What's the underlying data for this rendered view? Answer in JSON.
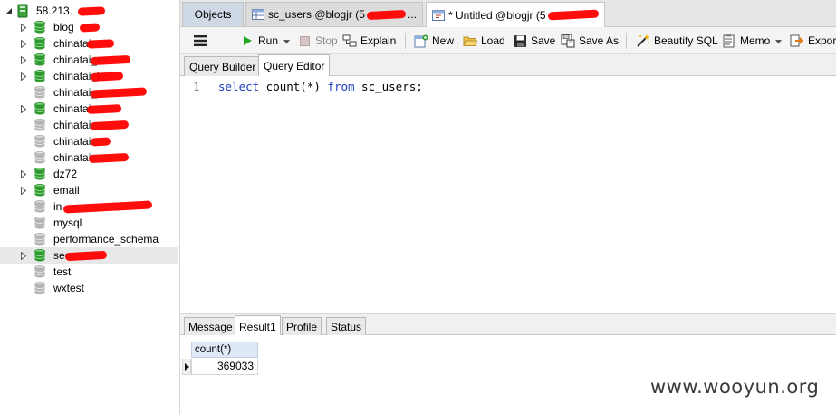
{
  "sidebar": {
    "connection_label": "58.213.",
    "items": [
      {
        "label": "blog",
        "icon": "green",
        "expandable": true
      },
      {
        "label": "chinatai",
        "icon": "green",
        "expandable": true
      },
      {
        "label": "chinatai_c",
        "icon": "green",
        "expandable": true
      },
      {
        "label": "chinatai_l",
        "icon": "green",
        "expandable": true
      },
      {
        "label": "chinatai_",
        "icon": "gray",
        "expandable": false
      },
      {
        "label": "chinatai",
        "icon": "green",
        "expandable": true
      },
      {
        "label": "chinatai",
        "icon": "gray",
        "expandable": false
      },
      {
        "label": "chinatai",
        "icon": "gray",
        "expandable": false
      },
      {
        "label": "chinatai",
        "icon": "gray",
        "expandable": false
      },
      {
        "label": "dz72",
        "icon": "green",
        "expandable": true
      },
      {
        "label": "email",
        "icon": "green",
        "expandable": true
      },
      {
        "label": "in",
        "icon": "gray",
        "expandable": false
      },
      {
        "label": "mysql",
        "icon": "gray",
        "expandable": false
      },
      {
        "label": "performance_schema",
        "icon": "gray",
        "expandable": false
      },
      {
        "label": "sec",
        "icon": "green",
        "expandable": true
      },
      {
        "label": "test",
        "icon": "gray",
        "expandable": false
      },
      {
        "label": "wxtest",
        "icon": "gray",
        "expandable": false
      }
    ]
  },
  "tabs": {
    "objects": "Objects",
    "table_tab": "sc_users @blogjr (5",
    "query_tab": "* Untitled @blogjr (5"
  },
  "toolbar": {
    "run": "Run",
    "stop": "Stop",
    "explain": "Explain",
    "new": "New",
    "load": "Load",
    "save": "Save",
    "save_as": "Save As",
    "beautify": "Beautify SQL",
    "memo": "Memo",
    "export": "Expor"
  },
  "subtabs": {
    "builder": "Query Builder",
    "editor": "Query Editor"
  },
  "editor": {
    "line_number": "1",
    "kw_select": "select",
    "fn_part": " count(*) ",
    "kw_from": "from",
    "rest": " sc_users;"
  },
  "result_tabs": {
    "message": "Message",
    "result1": "Result1",
    "profile": "Profile",
    "status": "Status"
  },
  "result": {
    "column": "count(*)",
    "value": "369033"
  },
  "watermark": "www.wooyun.org",
  "colors": {
    "db_green": "#2e9a2e",
    "db_gray": "#b4b4b4",
    "keyword": "#1f3fbf",
    "redaction": "#ff0000"
  }
}
